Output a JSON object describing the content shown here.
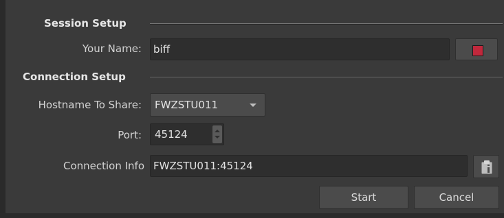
{
  "session_setup": {
    "title": "Session Setup",
    "name_label": "Your Name:",
    "name_value": "biff",
    "color_button": {
      "icon": "color-swatch-icon",
      "color": "#c0283c"
    }
  },
  "connection_setup": {
    "title": "Connection Setup",
    "hostname_label": "Hostname To Share:",
    "hostname_value": "FWZSTU011",
    "port_label": "Port:",
    "port_value": "45124",
    "info_label": "Connection Info",
    "info_value": "FWZSTU011:45124",
    "copy_icon": "clipboard-icon"
  },
  "buttons": {
    "start_label": "Start",
    "cancel_label": "Cancel"
  }
}
